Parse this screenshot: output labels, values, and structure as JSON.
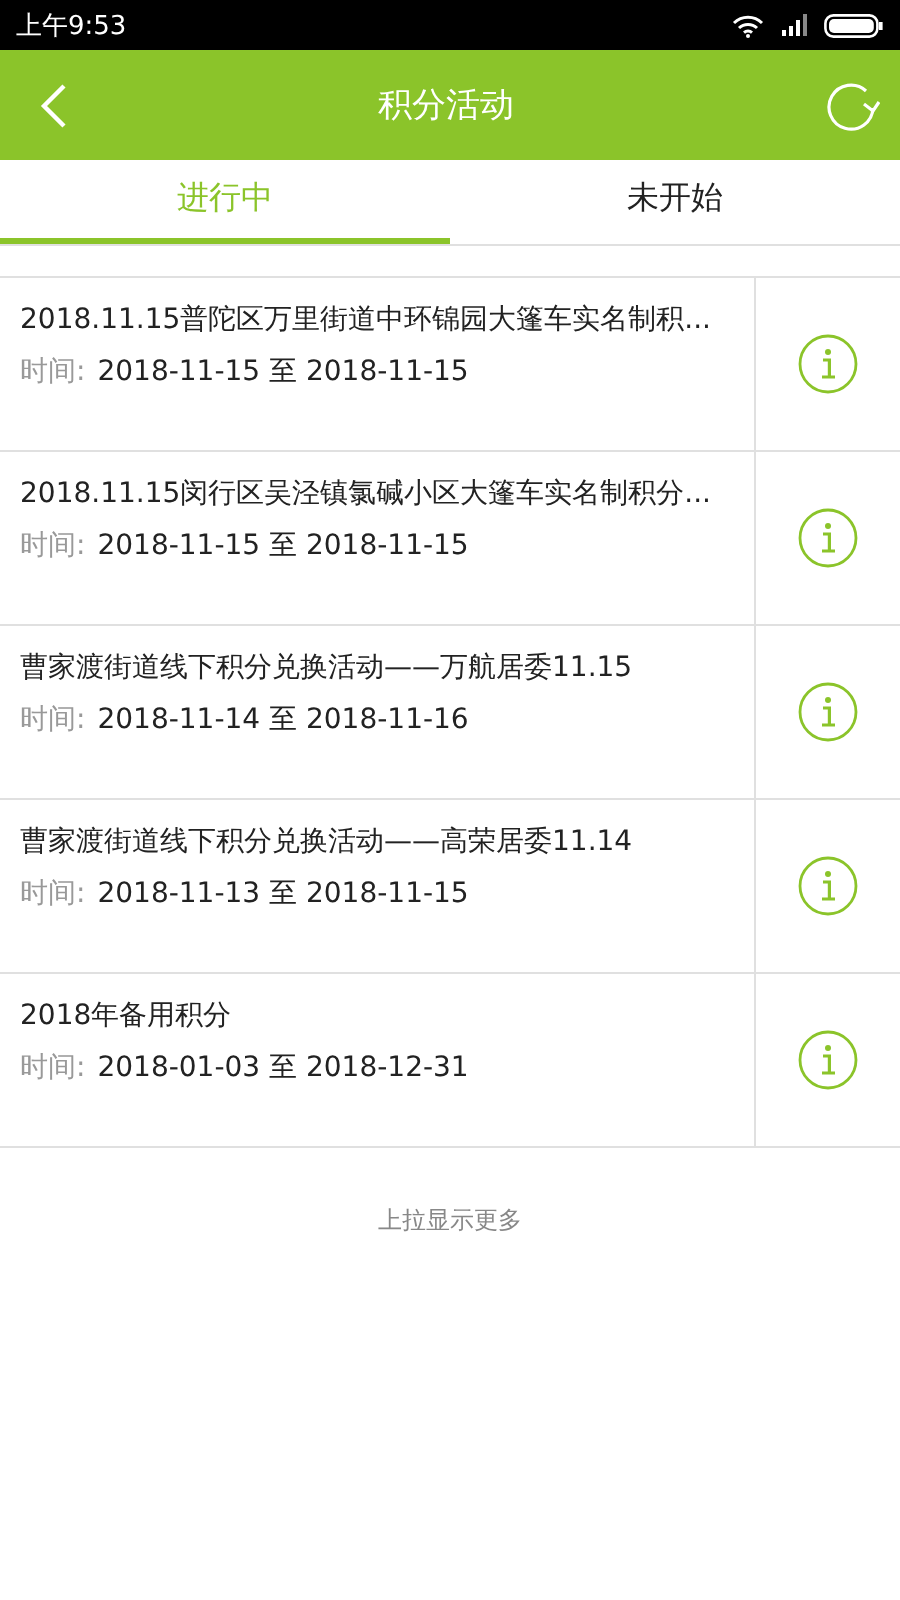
{
  "status_bar": {
    "time": "上午9:53"
  },
  "header": {
    "title": "积分活动"
  },
  "tabs": [
    {
      "label": "进行中",
      "selected": true
    },
    {
      "label": "未开始",
      "selected": false
    }
  ],
  "activities": [
    {
      "title": "2018.11.15普陀区万里街道中环锦园大篷车实名制积...",
      "time_label": "时间:",
      "time_range": "2018-11-15 至 2018-11-15"
    },
    {
      "title": "2018.11.15闵行区吴泾镇氯碱小区大篷车实名制积分...",
      "time_label": "时间:",
      "time_range": "2018-11-15 至 2018-11-15"
    },
    {
      "title": "曹家渡街道线下积分兑换活动——万航居委11.15",
      "time_label": "时间:",
      "time_range": "2018-11-14 至 2018-11-16"
    },
    {
      "title": "曹家渡街道线下积分兑换活动——高荣居委11.14",
      "time_label": "时间:",
      "time_range": "2018-11-13 至 2018-11-15"
    },
    {
      "title": "2018年备用积分",
      "time_label": "时间:",
      "time_range": "2018-01-03 至 2018-12-31"
    }
  ],
  "load_more": "上拉显示更多"
}
